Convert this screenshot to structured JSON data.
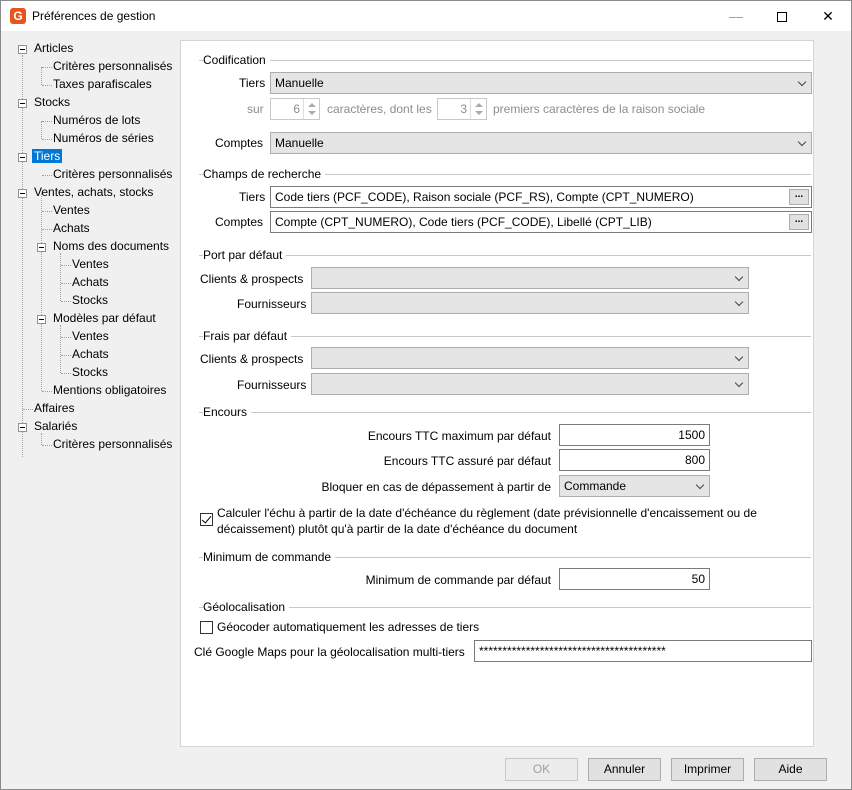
{
  "window": {
    "title": "Préférences de gestion",
    "app_icon": "G"
  },
  "tree": {
    "articles": "Articles",
    "articles_crit": "Critères personnalisés",
    "articles_taxes": "Taxes parafiscales",
    "stocks": "Stocks",
    "stocks_lots": "Numéros de lots",
    "stocks_series": "Numéros de séries",
    "tiers": "Tiers",
    "tiers_crit": "Critères personnalisés",
    "vas": "Ventes, achats, stocks",
    "vas_ventes": "Ventes",
    "vas_achats": "Achats",
    "noms_docs": "Noms des documents",
    "noms_ventes": "Ventes",
    "noms_achats": "Achats",
    "noms_stocks": "Stocks",
    "modeles": "Modèles par défaut",
    "mod_ventes": "Ventes",
    "mod_achats": "Achats",
    "mod_stocks": "Stocks",
    "mentions": "Mentions obligatoires",
    "affaires": "Affaires",
    "salaries": "Salariés",
    "sal_crit": "Critères personnalisés"
  },
  "codification": {
    "title": "Codification",
    "tiers_label": "Tiers",
    "tiers_value": "Manuelle",
    "sur_label": "sur",
    "sur_value": "6",
    "caracteres_label": "caractères,  dont les",
    "premiers_value": "3",
    "premiers_label": "premiers caractères de la raison sociale",
    "comptes_label": "Comptes",
    "comptes_value": "Manuelle"
  },
  "recherche": {
    "title": "Champs de recherche",
    "tiers_label": "Tiers",
    "tiers_value": "Code tiers (PCF_CODE), Raison sociale (PCF_RS), Compte (CPT_NUMERO)",
    "comptes_label": "Comptes",
    "comptes_value": "Compte (CPT_NUMERO), Code tiers (PCF_CODE), Libellé (CPT_LIB)",
    "ellipsis": "..."
  },
  "port": {
    "title": "Port par défaut",
    "clients_label": "Clients & prospects",
    "fourn_label": "Fournisseurs"
  },
  "frais": {
    "title": "Frais par défaut",
    "clients_label": "Clients & prospects",
    "fourn_label": "Fournisseurs"
  },
  "encours": {
    "title": "Encours",
    "max_label": "Encours TTC maximum par défaut",
    "max_value": "1500",
    "assure_label": "Encours TTC assuré par défaut",
    "assure_value": "800",
    "bloquer_label": "Bloquer en cas de dépassement à partir de",
    "bloquer_value": "Commande",
    "calc_label_1": "Calculer l'échu à partir de la date d'échéance du règlement (date prévisionnelle d'encaissement ou de",
    "calc_label_2": "décaissement) plutôt qu'à partir de la date d'échéance du document",
    "calc_checked": true
  },
  "minimum": {
    "title": "Minimum de commande",
    "label": "Minimum de commande par défaut",
    "value": "50"
  },
  "geo": {
    "title": "Géolocalisation",
    "auto_label": "Géocoder automatiquement les adresses de tiers",
    "auto_checked": false,
    "key_label": "Clé Google Maps pour la géolocalisation multi-tiers",
    "key_value": "****************************************"
  },
  "buttons": {
    "ok": "OK",
    "annuler": "Annuler",
    "imprimer": "Imprimer",
    "aide": "Aide"
  },
  "colors": {
    "selection": "#0078d7",
    "app_icon": "#e8541e"
  }
}
